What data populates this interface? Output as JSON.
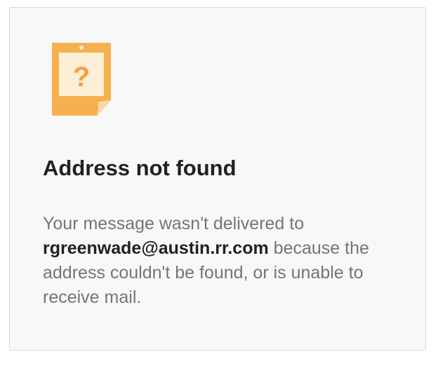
{
  "notice": {
    "icon": "unknown-address-note-icon",
    "icon_glyph": "?",
    "colors": {
      "icon_fill": "#f6b14f",
      "icon_inner": "#fdeed6",
      "icon_fold": "#f3a043",
      "icon_glyph": "#f3a043",
      "title": "#202124",
      "body": "#757575",
      "background": "#f8f8f8",
      "border": "#d8d8d8"
    },
    "title": "Address not found",
    "message": {
      "line1": "Your message wasn't delivered to",
      "recipient": "rgreenwade@austin.rr.com",
      "rest": " because the address couldn't be found, or is unable to receive mail."
    }
  }
}
